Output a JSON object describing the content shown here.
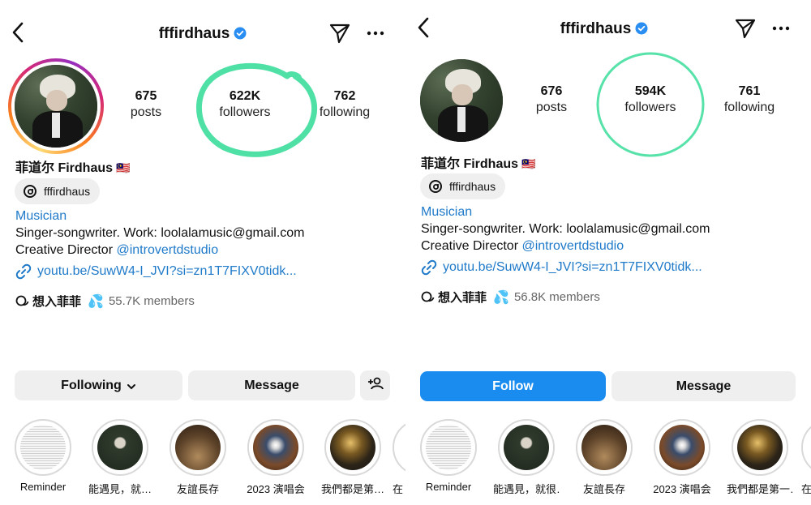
{
  "left": {
    "username": "fffirdhaus",
    "stats": {
      "posts": {
        "value": "675",
        "label": "posts"
      },
      "followers": {
        "value": "622K",
        "label": "followers"
      },
      "following": {
        "value": "762",
        "label": "following"
      }
    },
    "display_name": "菲道尔 Firdhaus",
    "flag": "🇲🇾",
    "threads_handle": "fffirdhaus",
    "category": "Musician",
    "bio_line1": "Singer-songwriter. Work: loolalamusic@gmail.com",
    "bio_line2_prefix": "Creative Director ",
    "bio_mention": "@introvertdstudio",
    "link": "youtu.be/SuwW4-I_JVI?si=zn1T7FIXV0tidk...",
    "community": {
      "name": "想入菲菲",
      "members": "55.7K members"
    },
    "buttons": {
      "primary": "Following",
      "message": "Message"
    },
    "highlights": [
      "Reminder",
      "能遇見，就…",
      "友誼長存",
      "2023 演唱会",
      "我們都是第…",
      "在"
    ]
  },
  "right": {
    "username": "fffirdhaus",
    "stats": {
      "posts": {
        "value": "676",
        "label": "posts"
      },
      "followers": {
        "value": "594K",
        "label": "followers"
      },
      "following": {
        "value": "761",
        "label": "following"
      }
    },
    "display_name": "菲道尔 Firdhaus",
    "flag": "🇲🇾",
    "threads_handle": "fffirdhaus",
    "category": "Musician",
    "bio_line1": "Singer-songwriter. Work: loolalamusic@gmail.com",
    "bio_line2_prefix": "Creative Director ",
    "bio_mention": "@introvertdstudio",
    "link": "youtu.be/SuwW4-I_JVI?si=zn1T7FIXV0tidk...",
    "community": {
      "name": "想入菲菲",
      "members": "56.8K members"
    },
    "buttons": {
      "primary": "Follow",
      "message": "Message"
    },
    "highlights": [
      "Reminder",
      "能遇見，就很…",
      "友誼長存",
      "2023 演唱会",
      "我們都是第一…",
      "在"
    ]
  },
  "colors": {
    "link_blue": "#1f7ac9",
    "follow_button": "#1a8cf0",
    "annotation_green": "#4fe0a6",
    "story_ring_gradient": [
      "#feda75",
      "#fa7e1e",
      "#d62976",
      "#962fbf"
    ]
  },
  "icons": [
    "back-icon",
    "verified-icon",
    "send-icon",
    "more-icon",
    "threads-icon",
    "link-icon",
    "community-icon",
    "add-person-icon",
    "chevron-down-icon"
  ]
}
